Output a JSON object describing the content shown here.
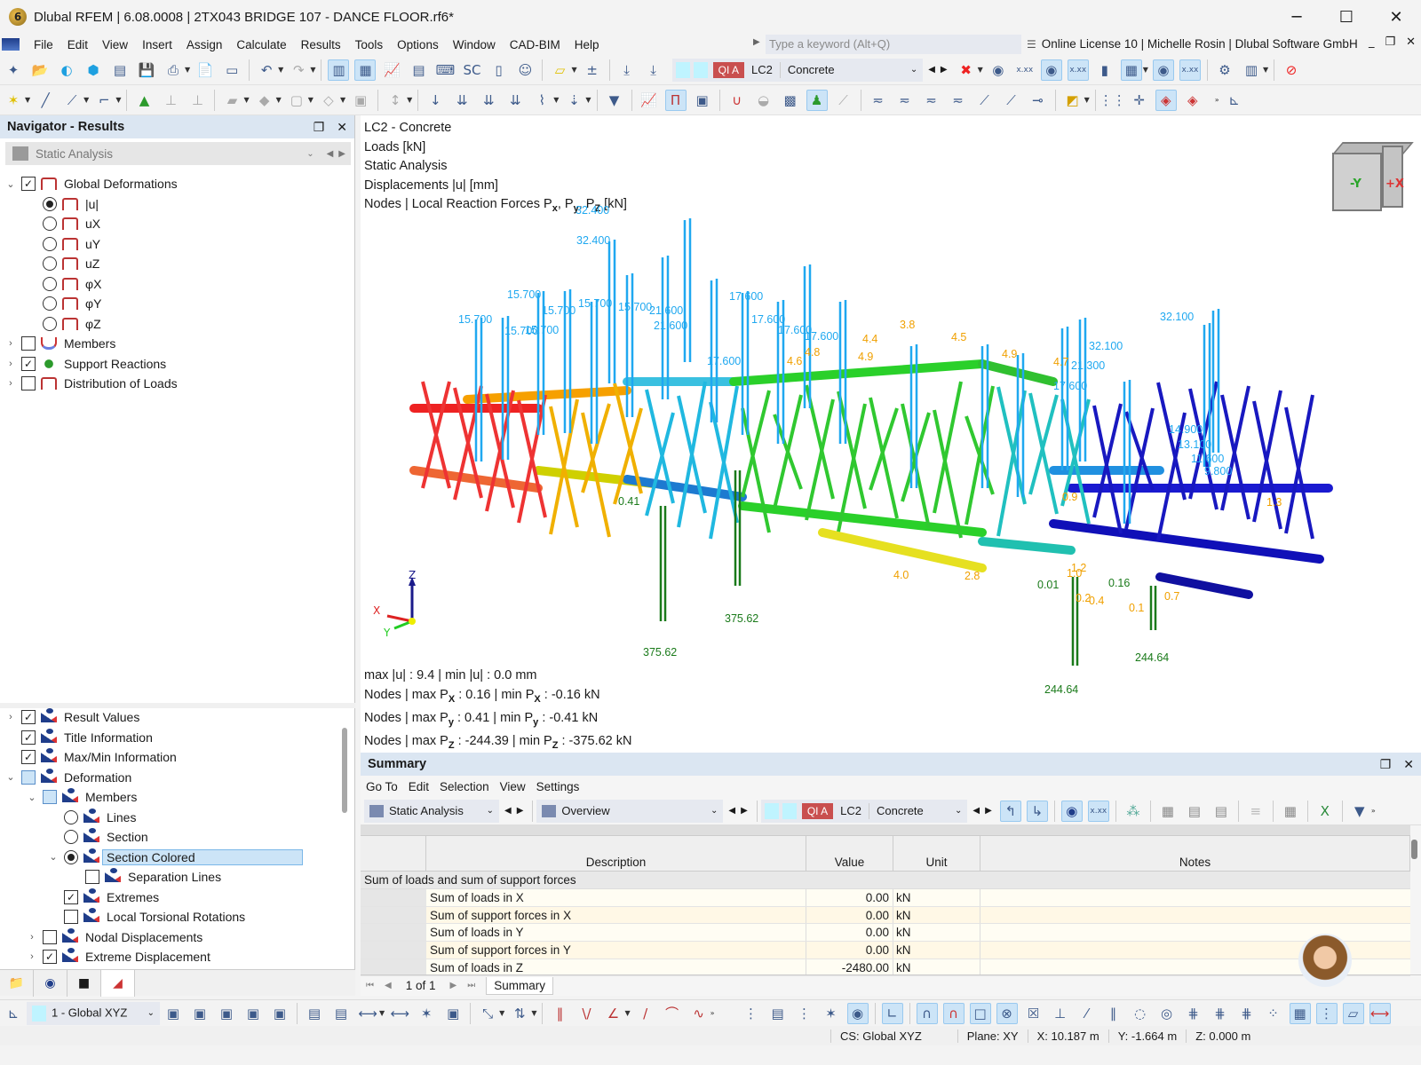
{
  "window": {
    "title": "Dlubal RFEM | 6.08.0008 | 2TX043 BRIDGE 107 - DANCE FLOOR.rf6*",
    "controls": {
      "minimize": "─",
      "maximize": "☐",
      "close": "✕"
    }
  },
  "menu": {
    "items": [
      "File",
      "Edit",
      "View",
      "Insert",
      "Assign",
      "Calculate",
      "Results",
      "Tools",
      "Options",
      "Window",
      "CAD-BIM",
      "Help"
    ],
    "search_placeholder": "Type a keyword (Alt+Q)",
    "license": "Online License 10 | Michelle Rosin | Dlubal Software GmbH"
  },
  "toolbar": {
    "load_case_badge": "QI A",
    "load_case": "LC2",
    "load_case_name": "Concrete"
  },
  "navigator": {
    "title": "Navigator - Results",
    "analysis_combo": "Static Analysis",
    "top_tree": [
      {
        "label": "Global Deformations",
        "type": "check",
        "checked": true,
        "expanded": true,
        "level": 0,
        "icon": "frame"
      },
      {
        "label": "|u|",
        "type": "radio",
        "checked": true,
        "level": 1,
        "icon": "frame"
      },
      {
        "label": "uX",
        "type": "radio",
        "checked": false,
        "level": 1,
        "icon": "frame"
      },
      {
        "label": "uY",
        "type": "radio",
        "checked": false,
        "level": 1,
        "icon": "frame"
      },
      {
        "label": "uZ",
        "type": "radio",
        "checked": false,
        "level": 1,
        "icon": "frame"
      },
      {
        "label": "φX",
        "type": "radio",
        "checked": false,
        "level": 1,
        "icon": "frame"
      },
      {
        "label": "φY",
        "type": "radio",
        "checked": false,
        "level": 1,
        "icon": "frame"
      },
      {
        "label": "φZ",
        "type": "radio",
        "checked": false,
        "level": 1,
        "icon": "frame"
      },
      {
        "label": "Members",
        "type": "check",
        "checked": false,
        "collapsed": true,
        "level": 0,
        "icon": "mem"
      },
      {
        "label": "Support Reactions",
        "type": "check",
        "checked": true,
        "collapsed": true,
        "level": 0,
        "icon": "sup"
      },
      {
        "label": "Distribution of Loads",
        "type": "check",
        "checked": false,
        "collapsed": true,
        "level": 0,
        "icon": "frame"
      }
    ],
    "bottom_tree": [
      {
        "label": "Result Values",
        "type": "check",
        "checked": true,
        "collapsed": true,
        "level": 0
      },
      {
        "label": "Title Information",
        "type": "check",
        "checked": true,
        "level": 0
      },
      {
        "label": "Max/Min Information",
        "type": "check",
        "checked": true,
        "level": 0
      },
      {
        "label": "Deformation",
        "type": "check",
        "partial": true,
        "expanded": true,
        "level": 0
      },
      {
        "label": "Members",
        "type": "check",
        "partial": true,
        "expanded": true,
        "level": 1
      },
      {
        "label": "Lines",
        "type": "radio",
        "checked": false,
        "level": 2
      },
      {
        "label": "Section",
        "type": "radio",
        "checked": false,
        "level": 2
      },
      {
        "label": "Section Colored",
        "type": "radio",
        "checked": true,
        "expanded": true,
        "selected": true,
        "level": 2
      },
      {
        "label": "Separation Lines",
        "type": "check",
        "checked": false,
        "level": 3
      },
      {
        "label": "Extremes",
        "type": "check",
        "checked": true,
        "level": 2
      },
      {
        "label": "Local Torsional Rotations",
        "type": "check",
        "checked": false,
        "level": 2
      },
      {
        "label": "Nodal Displacements",
        "type": "check",
        "checked": false,
        "collapsed": true,
        "level": 1
      },
      {
        "label": "Extreme Displacement",
        "type": "check",
        "checked": true,
        "collapsed": true,
        "level": 1
      }
    ]
  },
  "viewport": {
    "info_lines": [
      "LC2 - Concrete",
      "Loads [kN]",
      "Static Analysis",
      "Displacements |u| [mm]"
    ],
    "info_reaction": {
      "prefix": "Nodes | Local Reaction Forces P",
      "x": "x",
      "y": "y",
      "z": "Z",
      "unit": " [kN]"
    },
    "maxmin": {
      "u": "max |u| : 9.4 | min |u| : 0.0 mm",
      "px": {
        "a": "Nodes | max P",
        "sub": "X",
        "b": " : 0.16 | min P",
        "c": " : -0.16 kN"
      },
      "py": {
        "a": "Nodes | max P",
        "sub": "y",
        "b": " : 0.41 | min P",
        "c": " : -0.41 kN"
      },
      "pz": {
        "a": "Nodes | max P",
        "sub": "Z",
        "b": " : -244.39 | min P",
        "c": " : -375.62 kN"
      }
    },
    "cube_labels": {
      "y": "-Y",
      "x": "+X"
    },
    "axes": {
      "x": "X",
      "y": "Y",
      "z": "Z"
    },
    "load_labels": [
      "32.400",
      "32.400",
      "15.700",
      "15.700",
      "15.700",
      "15.700",
      "15.700",
      "15.700",
      "15.700",
      "21.600",
      "21.600",
      "17.600",
      "17.600",
      "17.600",
      "17.600",
      "17.600",
      "32.100",
      "32.100",
      "21.300",
      "17.600",
      "14.900",
      "13.100",
      "11.600",
      "9.800"
    ],
    "reaction_labels": [
      "375.62",
      "375.62",
      "244.64",
      "244.64",
      "0.41",
      "0.01",
      "0.16"
    ],
    "displacement_labels": [
      "4.5",
      "4.9",
      "4.7",
      "3.8",
      "4.4",
      "4.6",
      "4.8",
      "4.9",
      "1.0",
      "1.2",
      "0.9",
      "0.4",
      "0.2",
      "0.1",
      "0.7",
      "1.3",
      "2.8",
      "4.0"
    ]
  },
  "summary": {
    "title": "Summary",
    "menu": [
      "Go To",
      "Edit",
      "Selection",
      "View",
      "Settings"
    ],
    "analysis_combo": "Static Analysis",
    "view_combo": "Overview",
    "load_case_badge": "QI A",
    "load_case": "LC2",
    "load_case_name": "Concrete",
    "columns": [
      "Description",
      "Value",
      "Unit",
      "Notes"
    ],
    "group": "Sum of loads and sum of support forces",
    "rows": [
      {
        "desc": "Sum of loads in X",
        "value": "0.00",
        "unit": "kN"
      },
      {
        "desc": "Sum of support forces in X",
        "value": "0.00",
        "unit": "kN"
      },
      {
        "desc": "Sum of loads in Y",
        "value": "0.00",
        "unit": "kN"
      },
      {
        "desc": "Sum of support forces in Y",
        "value": "0.00",
        "unit": "kN"
      },
      {
        "desc": "Sum of loads in Z",
        "value": "-2480.00",
        "unit": "kN"
      }
    ],
    "pager": "1 of 1",
    "tab": "Summary"
  },
  "bottom_toolbar": {
    "cs_combo": "1 - Global XYZ"
  },
  "statusbar": {
    "cs": "CS: Global XYZ",
    "plane": "Plane: XY",
    "x": "X: 10.187 m",
    "y": "Y: -1.664 m",
    "z": "Z: 0.000 m"
  }
}
